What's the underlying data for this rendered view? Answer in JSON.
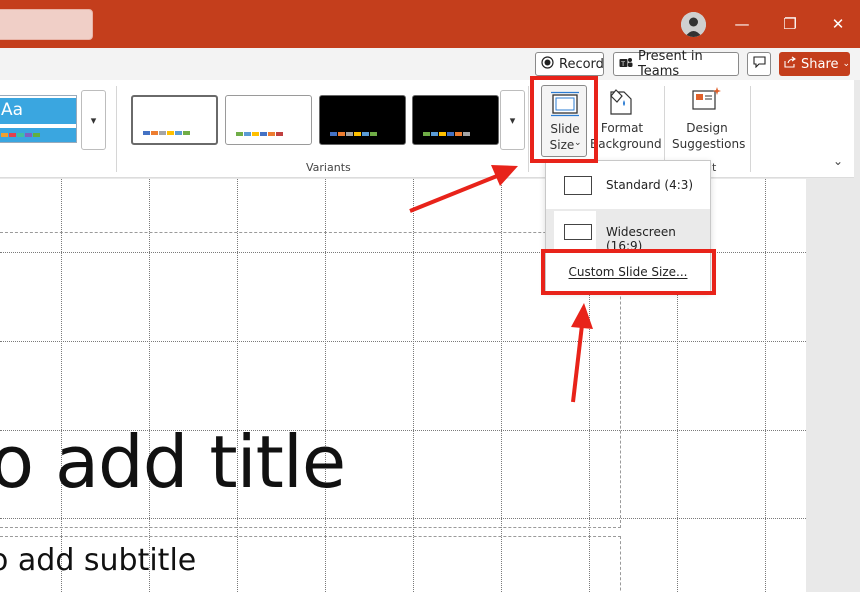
{
  "titlebar": {
    "window_controls": {
      "minimize": "—",
      "restore": "❐",
      "close": "✕"
    }
  },
  "command_bar": {
    "record_label": "Record",
    "present_teams_label": "Present in Teams",
    "share_label": "Share"
  },
  "ribbon": {
    "theme_sample_text": "Aa",
    "variants_group_label": "Variants",
    "slide_size": {
      "line1": "Slide",
      "line2": "Size"
    },
    "format_background": {
      "line1": "Format",
      "line2": "Background"
    },
    "design_suggestions": {
      "line1": "Design",
      "line2": "Suggestions"
    },
    "partial_group_label": "it"
  },
  "dropdown": {
    "standard_label": "Standard (4:3)",
    "widescreen_label": "Widescreen (16:9)",
    "custom_label": "Custom Slide Size..."
  },
  "slide": {
    "title_text": "o add title",
    "subtitle_text": "o add subtitle"
  },
  "colors": {
    "brand": "#c43e1c",
    "highlight": "#e8231a"
  }
}
